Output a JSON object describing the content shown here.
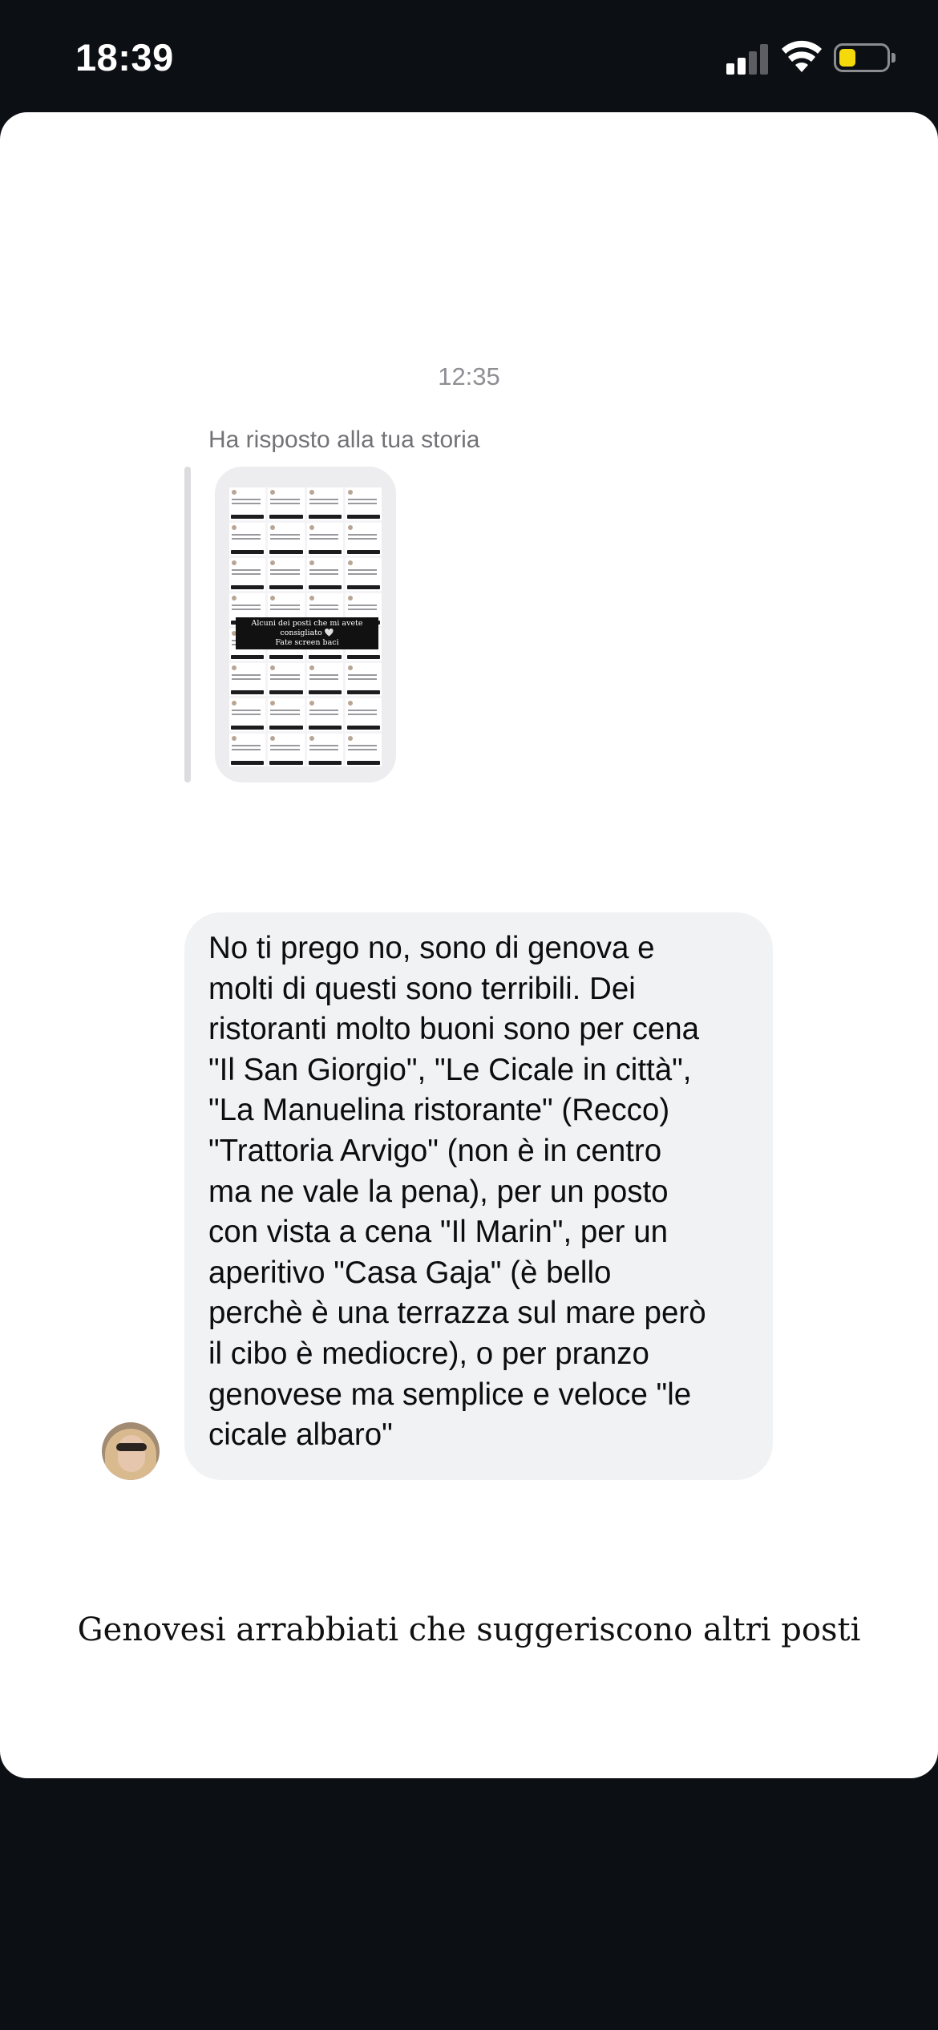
{
  "status_bar": {
    "time": "18:39",
    "signal_bars_active": 2,
    "battery_fill_fraction": 0.35,
    "battery_color": "#f5d90a"
  },
  "chat": {
    "timestamp": "12:35",
    "reply_label": "Ha risposto alla tua storia",
    "story_preview": {
      "caption_line1": "Alcuni dei posti che mi avete consigliato 🤍",
      "caption_line2": "Fate screen baci"
    },
    "message": "No ti prego no, sono di genova e\nmolti di questi sono terribili. Dei\nristoranti molto buoni sono per cena\n\"Il San Giorgio\", \"Le Cicale in città\",\n\"La Manuelina ristorante\" (Recco)\n\"Trattoria Arvigo\" (non è in centro\nma ne vale la pena), per un posto\ncon vista a cena \"Il Marin\", per un\naperitivo \"Casa Gaja\" (è bello\nperchè è una terrazza sul mare però\nil cibo è mediocre), o per pranzo\ngenovese ma semplice e veloce \"le\ncicale albaro\""
  },
  "caption": "Genovesi arrabbiati che suggeriscono altri posti"
}
